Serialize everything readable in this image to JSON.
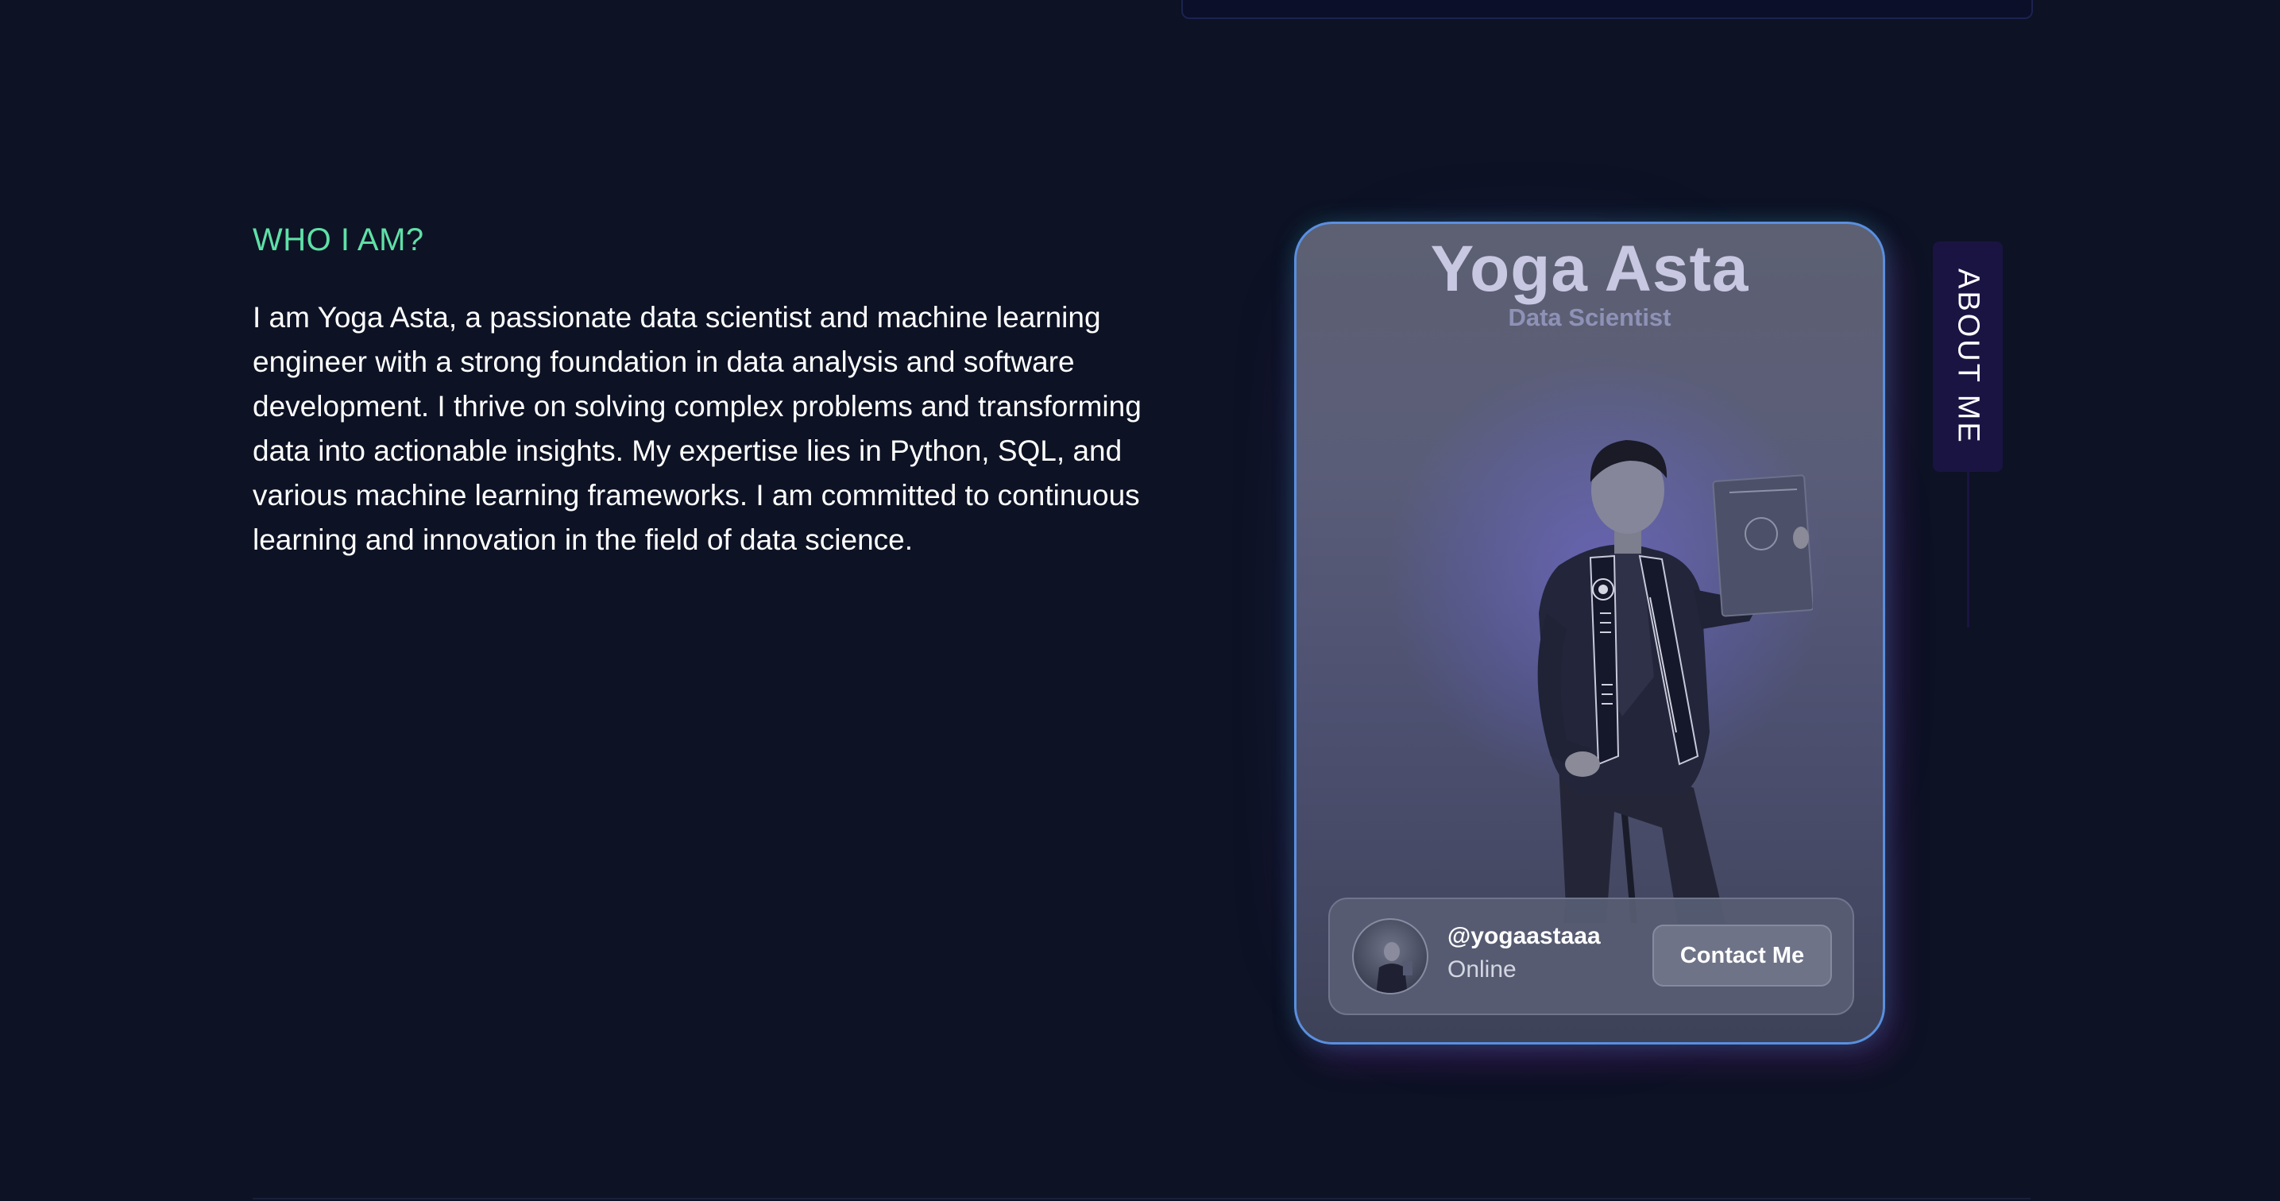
{
  "about": {
    "heading": "WHO I AM?",
    "text": "I am Yoga Asta, a passionate data scientist and machine learning engineer with a strong foundation in data analysis and software development. I thrive on solving complex problems and transforming data into actionable insights. My expertise lies in Python, SQL, and various machine learning frameworks. I am committed to continuous learning and innovation in the field of data science."
  },
  "profile_card": {
    "name": "Yoga Asta",
    "role": "Data Scientist",
    "handle": "@yogaastaaa",
    "status": "Online",
    "contact_label": "Contact Me",
    "photo_icon": "graduate-portrait"
  },
  "side_tab": {
    "label": "ABOUT ME"
  },
  "colors": {
    "background": "#0d1224",
    "heading_accent": "#5fe0a7",
    "card_border": "#5a8fe0",
    "side_tab": "#1a1443"
  }
}
